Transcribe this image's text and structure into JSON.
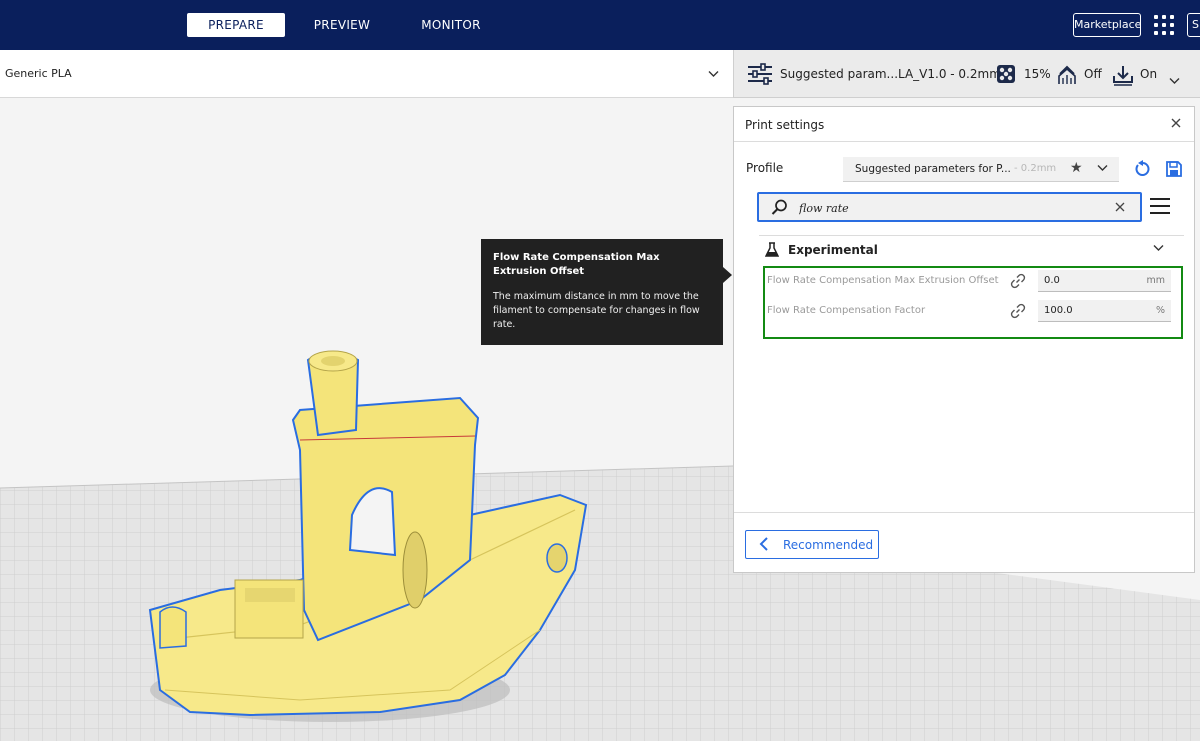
{
  "stages": [
    {
      "label": "PREPARE",
      "active": true
    },
    {
      "label": "PREVIEW",
      "active": false
    },
    {
      "label": "MONITOR",
      "active": false
    }
  ],
  "header": {
    "marketplace_label": "Marketplace",
    "signin_label": "Si"
  },
  "material": {
    "label": "Generic PLA"
  },
  "print_summary": {
    "profile": "Suggested param...LA_V1.0 - 0.2mm",
    "infill": "15%",
    "support": "Off",
    "adhesion": "On"
  },
  "tooltip": {
    "title": "Flow Rate Compensation Max Extrusion Offset",
    "body": "The maximum distance in mm to move the filament to compensate for changes in flow rate."
  },
  "panel": {
    "title": "Print settings",
    "profile_label": "Profile",
    "profile_value": "Suggested parameters for P...",
    "profile_dim": "- 0.2mm",
    "search_value": "flow rate",
    "category": "Experimental",
    "settings": [
      {
        "label": "Flow Rate Compensation Max Extrusion Offset",
        "value": "0.0",
        "unit": "mm"
      },
      {
        "label": "Flow Rate Compensation Factor",
        "value": "100.0",
        "unit": "%"
      }
    ],
    "recommended_label": "Recommended"
  },
  "colors": {
    "header_bg": "#0a1f5c",
    "accent": "#2a6de1",
    "highlight": "#138a13",
    "model": "#f7e98a"
  }
}
